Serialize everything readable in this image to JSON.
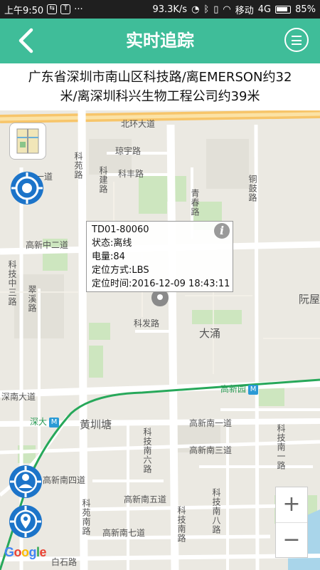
{
  "status_bar": {
    "time": "上午9:50",
    "speed": "93.3K/s",
    "carrier": "移动",
    "network": "4G",
    "battery": "85%"
  },
  "header": {
    "title": "实时追踪",
    "back_icon": "chevron-left-icon",
    "menu_icon": "hamburger-menu-icon",
    "color": "#3fbd99"
  },
  "address": {
    "line1": "广东省深圳市南山区科技路/离EMERSON约32",
    "line2": "米/离深圳科兴生物工程公司约39米"
  },
  "map": {
    "labels": {
      "beihuan": "北环大道",
      "qiongyu": "琼宇路",
      "kefeng": "科丰路",
      "kexue": "科苑路",
      "kejian": "科建路",
      "qingda": "青春路",
      "tongxin": "铜鼓路",
      "gaoxin_zhong2": "高新中二道",
      "keji_zhong3": "科技中三路",
      "yiyuan": "翠溪路",
      "kefa": "科发路",
      "dachong": "大涌",
      "ruanwu": "阮屋",
      "shennan": "深南大道",
      "gaoxinyuan": "高新园",
      "shenda": "深大",
      "huanggangtang": "黄圳塘",
      "gaoxin_nan1": "高新南一道",
      "gaoxin_nan3": "高新南三道",
      "gaoxin_nan4": "高新南四道",
      "gaoxin_nan5": "高新南五道",
      "gaoxin_nan7": "高新南七道",
      "keji_nan6": "科技南六路",
      "keji_nan8": "科技南八路",
      "keji_nan1": "科技南一路",
      "kejinan": "科技南路",
      "keyuan_nan": "科苑南路",
      "baishi": "白石路",
      "yi_dao": "一道",
      "metro_badge": "M"
    },
    "popup": {
      "device": "TD01-80060",
      "status": "状态:离线",
      "battery": "电量:84",
      "method": "定位方式:LBS",
      "time": "定位时间:2016-12-09 18:43:11"
    },
    "zoom_in": "+",
    "zoom_out": "−",
    "google": [
      "G",
      "o",
      "o",
      "g",
      "l",
      "e"
    ],
    "google_colors": [
      "#4285f4",
      "#ea4335",
      "#fbbc05",
      "#4285f4",
      "#34a853",
      "#ea4335"
    ]
  }
}
